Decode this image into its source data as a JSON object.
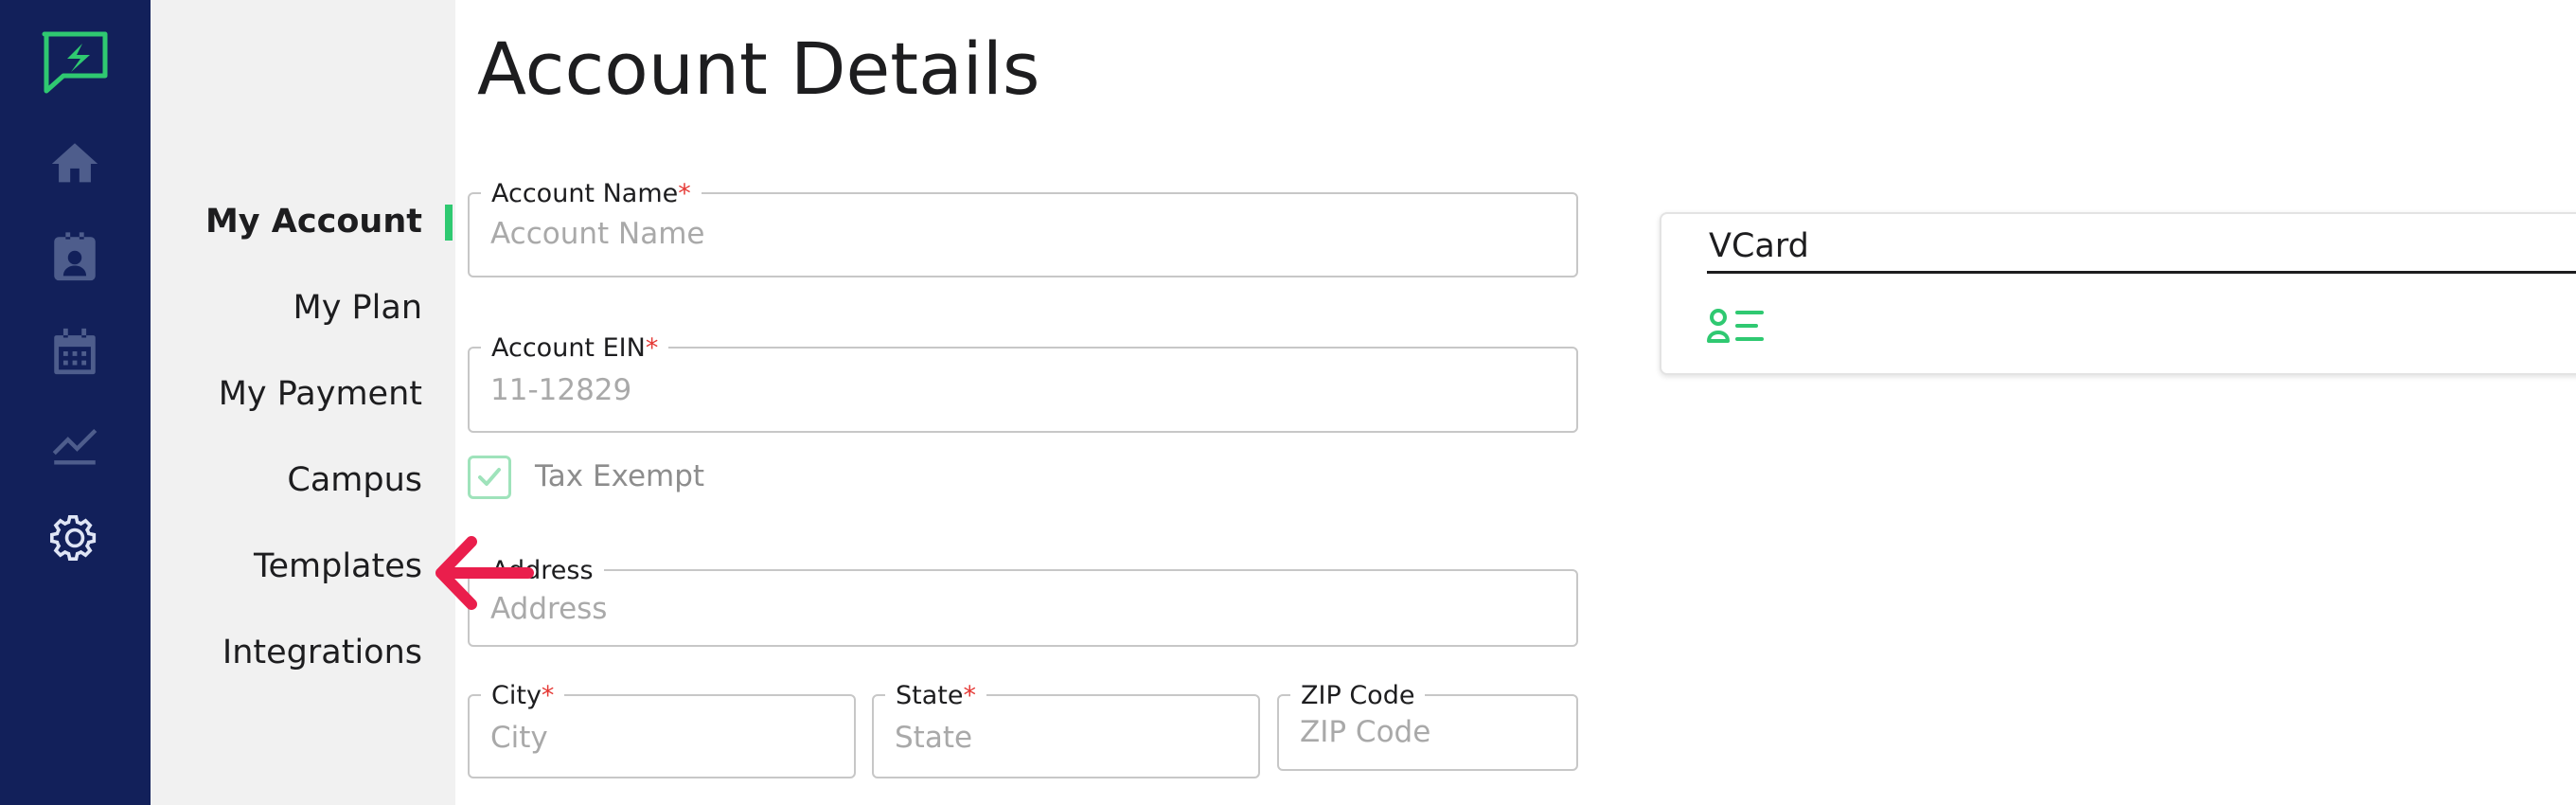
{
  "colors": {
    "rail": "#12205a",
    "accent": "#2fc971",
    "required": "#e53935",
    "annotation": "#ea1e4c"
  },
  "rail": {
    "logo_icon": "chat-bolt-logo-icon",
    "items": [
      {
        "icon": "home-icon"
      },
      {
        "icon": "contacts-icon"
      },
      {
        "icon": "calendar-icon"
      },
      {
        "icon": "analytics-icon"
      },
      {
        "icon": "gear-icon"
      }
    ]
  },
  "submenu": {
    "items": [
      {
        "label": "My Account",
        "active": true
      },
      {
        "label": "My Plan"
      },
      {
        "label": "My Payment"
      },
      {
        "label": "Campus"
      },
      {
        "label": "Templates"
      },
      {
        "label": "Integrations"
      }
    ]
  },
  "page": {
    "title": "Account Details"
  },
  "form": {
    "account_name": {
      "label": "Account Name",
      "required": "*",
      "placeholder": "Account Name",
      "value": ""
    },
    "account_ein": {
      "label": "Account EIN",
      "required": "*",
      "placeholder": "11-12829",
      "value": ""
    },
    "tax_exempt": {
      "label": "Tax Exempt",
      "checked": true
    },
    "address": {
      "label": "Address",
      "placeholder": "Address",
      "value": ""
    },
    "city": {
      "label": "City",
      "required": "*",
      "placeholder": "City",
      "value": ""
    },
    "state": {
      "label": "State",
      "required": "*",
      "placeholder": "State",
      "value": ""
    },
    "zip": {
      "label": "ZIP Code",
      "placeholder": "ZIP Code",
      "value": ""
    }
  },
  "vcard": {
    "title": "VCard",
    "icon": "contact-card-icon"
  },
  "annotation": {
    "icon": "arrow-left-icon"
  }
}
